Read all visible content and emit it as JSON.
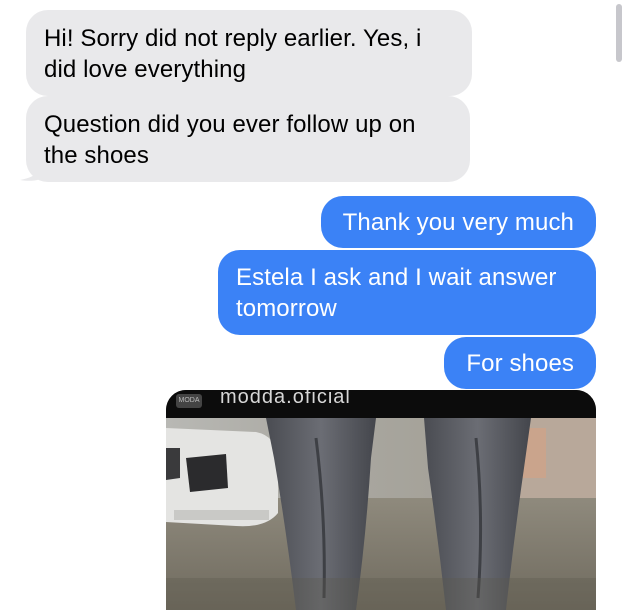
{
  "messages": [
    {
      "id": "m1",
      "direction": "incoming",
      "text": "Hi! Sorry did not reply earlier. Yes, i did love everything"
    },
    {
      "id": "m2",
      "direction": "incoming",
      "text": "Question did you ever follow up on the shoes"
    },
    {
      "id": "m3",
      "direction": "outgoing",
      "text": "Thank you very much"
    },
    {
      "id": "m4",
      "direction": "outgoing",
      "text": "Estela I ask and I wait answer tomorrow"
    },
    {
      "id": "m5",
      "direction": "outgoing",
      "text": "For shoes"
    }
  ],
  "shared_post": {
    "handle": "modda.oficial",
    "avatar_label": "MODA",
    "image": "photo of legs in grey jeans walking on a street with a white car in the background"
  },
  "colors": {
    "incoming_bubble": "#e9e9eb",
    "outgoing_bubble": "#3b82f6",
    "outgoing_text": "#ffffff"
  }
}
